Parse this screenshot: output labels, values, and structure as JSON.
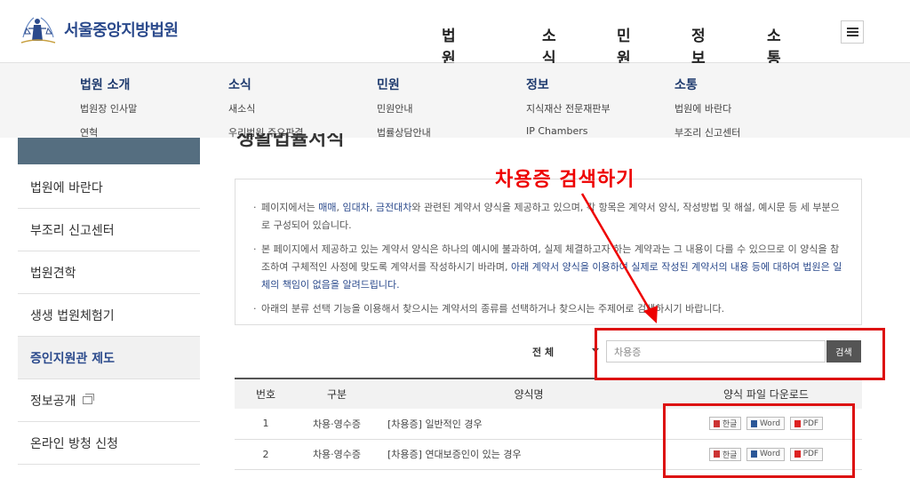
{
  "header": {
    "logo_text": "서울중앙지방법원",
    "nav": [
      "법원소개",
      "소식",
      "민원",
      "정보",
      "소통"
    ],
    "active_nav": "소통"
  },
  "mega_menu": [
    {
      "title": "법원 소개",
      "links": [
        "법원장 인사말",
        "연혁"
      ]
    },
    {
      "title": "소식",
      "links": [
        "새소식",
        "우리법원 주요판결"
      ]
    },
    {
      "title": "민원",
      "links": [
        "민원안내",
        "법률상담안내"
      ]
    },
    {
      "title": "정보",
      "links": [
        "지식재산 전문재판부",
        "IP Chambers"
      ]
    },
    {
      "title": "소통",
      "links": [
        "법원에 바란다",
        "부조리 신고센터"
      ]
    }
  ],
  "sidebar": {
    "items": [
      {
        "label": "법원에 바란다",
        "active": false
      },
      {
        "label": "부조리 신고센터",
        "active": false
      },
      {
        "label": "법원견학",
        "active": false
      },
      {
        "label": "생생 법원체험기",
        "active": false
      },
      {
        "label": "증인지원관 제도",
        "active": true
      },
      {
        "label": "정보공개",
        "active": false,
        "external": true
      },
      {
        "label": "온라인 방청 신청",
        "active": false
      }
    ]
  },
  "page_title_fragment": "생활법률서식",
  "annotation": {
    "text": "차용증 검색하기",
    "color": "#e00000"
  },
  "notice": {
    "p1_a": "페이지에서는 ",
    "p1_hl1": "매매",
    "p1_sep1": ", ",
    "p1_hl2": "임대차",
    "p1_sep2": ", ",
    "p1_hl3": "금전대차",
    "p1_b": "와 관련된 계약서 양식을 제공하고 있으며, 각 항목은 계약서 양식, 작성방법 및 해설, 예시문 등 세 부분으로 구성되어 있습니다.",
    "p2_a": "본 페이지에서 제공하고 있는 계약서 양식은 하나의 예시에 불과하여, 실제 체결하고자 하는 계약과는 그 내용이 다를 수 있으므로 이 양식을 참조하여 구체적인 사정에 맞도록 계약서를 작성하시기 바라며, ",
    "p2_hl": "아래 계약서 양식을 이용하여 실제로 작성된 계약서의 내용 등에 대하여 법원은 일체의 책임이 없음을 알려드립니다.",
    "p3": "아래의 분류 선택 기능을 이용해서 찾으시는 계약서의 종류를 선택하거나 찾으시는 주제어로 검색하시기 바랍니다."
  },
  "search": {
    "category_value": "전 체",
    "input_value": "차용증",
    "button_label": "검색"
  },
  "table": {
    "headers": [
      "번호",
      "구분",
      "양식명",
      "양식 파일 다운로드"
    ],
    "rows": [
      {
        "num": "1",
        "category": "차용·영수증",
        "name": "[차용증] 일반적인 경우"
      },
      {
        "num": "2",
        "category": "차용·영수증",
        "name": "[차용증] 연대보증인이 있는 경우"
      }
    ],
    "download_labels": [
      "한글",
      "Word",
      "PDF"
    ]
  }
}
